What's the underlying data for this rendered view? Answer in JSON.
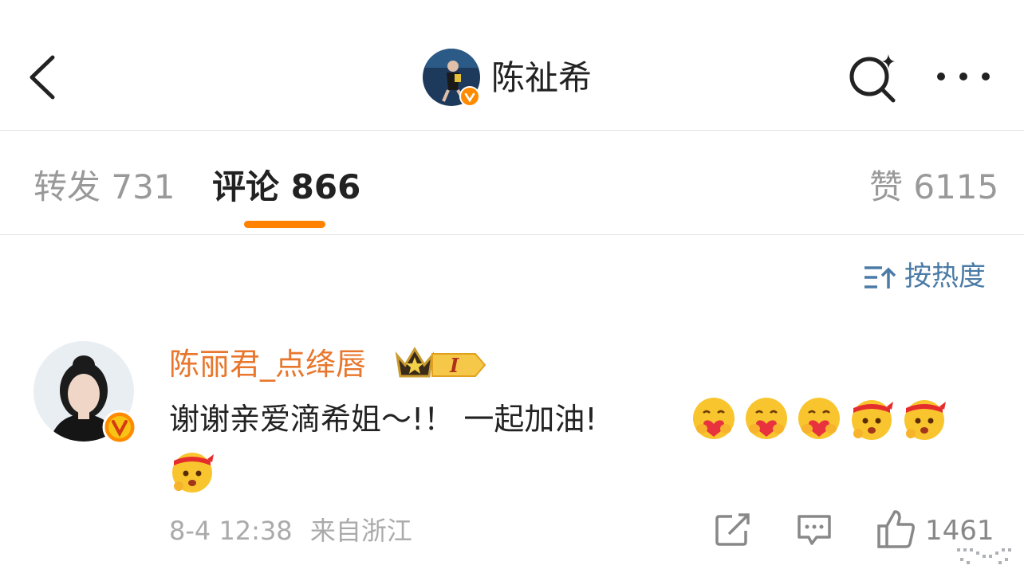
{
  "header": {
    "back_icon": "chevron-left-icon",
    "author_name": "陈祉希",
    "verified_badge": "verified-v-icon",
    "search_icon": "search-sparkle-icon",
    "more_icon": "more-dots-icon"
  },
  "tabs": [
    {
      "label": "转发 731",
      "active": false
    },
    {
      "label": "评论 866",
      "active": true
    },
    {
      "label": "赞 6115",
      "active": false
    }
  ],
  "sort": {
    "icon": "sort-icon",
    "label": "按热度"
  },
  "comment": {
    "user_name": "陈丽君_点绛唇",
    "membership_icon": "crown-icon",
    "level_badge": "I",
    "text": "谢谢亲爱滴希姐～!！ 一起加油!",
    "emojis": [
      "hug-emoji",
      "hug-emoji",
      "hug-emoji",
      "fighting-emoji",
      "fighting-emoji",
      "fighting-emoji"
    ],
    "timestamp": "8-4 12:38",
    "location": "来自浙江",
    "like_count": "1461"
  },
  "colors": {
    "accent_orange": "#ff8200",
    "username_orange": "#e8772d",
    "sort_blue": "#4a7ba7",
    "muted_gray": "#999999"
  }
}
